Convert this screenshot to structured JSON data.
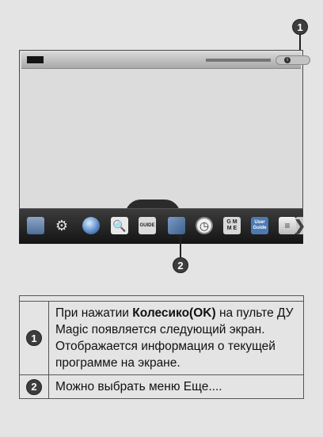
{
  "screen": {
    "callout_top": "1",
    "callout_bottom": "2",
    "info_pill_icon": "i"
  },
  "menubar": {
    "items": [
      {
        "name": "tv-icon",
        "glyph": ""
      },
      {
        "name": "settings-gear-icon",
        "glyph": "⚙"
      },
      {
        "name": "globe-icon",
        "glyph": ""
      },
      {
        "name": "search-icon",
        "glyph": "🔍"
      },
      {
        "name": "tv-guide-icon",
        "glyph": "GUIDE"
      },
      {
        "name": "apps-cubes-icon",
        "glyph": ""
      },
      {
        "name": "clock-icon",
        "glyph": "◷"
      },
      {
        "name": "game-icon",
        "glyph": "G M\nM E"
      },
      {
        "name": "user-guide-icon",
        "glyph": "User Guide"
      },
      {
        "name": "list-icon",
        "glyph": "≡"
      },
      {
        "name": "next-arrow-icon",
        "glyph": "❯"
      }
    ]
  },
  "table": {
    "rows": [
      {
        "num": "1",
        "text_prefix": "При нажатии ",
        "text_bold": "Колесико(OK)",
        "text_suffix": " на пульте ДУ Magic появляется следующий экран.",
        "text_line2": "Отображается информация о текущей программе на экране."
      },
      {
        "num": "2",
        "text": "Можно выбрать меню Еще...."
      }
    ]
  }
}
